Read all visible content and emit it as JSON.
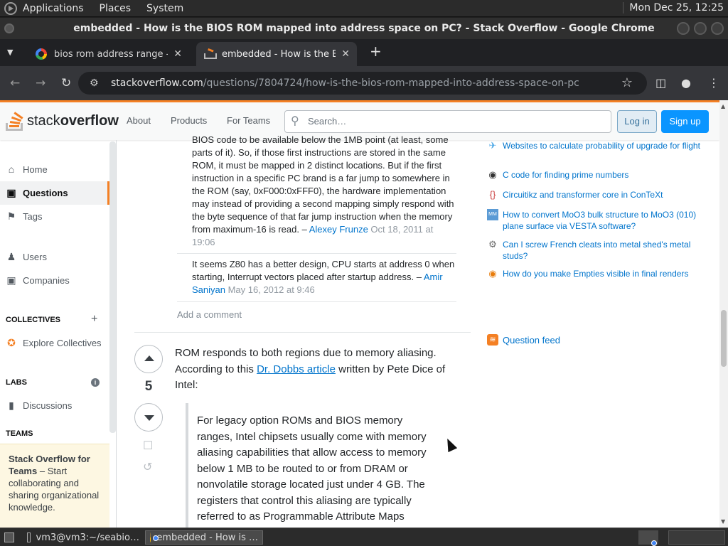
{
  "desktop": {
    "menus": [
      "Applications",
      "Places",
      "System"
    ],
    "clock": "Mon Dec 25, 12:25"
  },
  "window": {
    "title": "embedded - How is the BIOS ROM mapped into address space on PC? - Stack Overflow - Google Chrome"
  },
  "tabs": [
    {
      "title": "bios rom address range - Goo",
      "icon": "google-icon"
    },
    {
      "title": "embedded - How is the BIOS",
      "icon": "stackoverflow-icon"
    }
  ],
  "omnibox": {
    "domain": "stackoverflow.com",
    "path": "/questions/7804724/how-is-the-bios-rom-mapped-into-address-space-on-pc"
  },
  "so_header": {
    "logo_plain": "stack",
    "logo_bold": "overflow",
    "nav": [
      "About",
      "Products",
      "For Teams"
    ],
    "search_placeholder": "Search…",
    "login": "Log in",
    "signup": "Sign up"
  },
  "leftnav": {
    "home": "Home",
    "questions": "Questions",
    "tags": "Tags",
    "users": "Users",
    "companies": "Companies",
    "collectives_head": "COLLECTIVES",
    "explore_collectives": "Explore Collectives",
    "labs_head": "LABS",
    "discussions": "Discussions",
    "teams_head": "TEAMS",
    "teams_title": "Stack Overflow for Teams",
    "teams_desc": " – Start collaborating and sharing organizational knowledge."
  },
  "comments": [
    {
      "text": "BIOS code to be available below the 1MB point (at least, some parts of it). So, if those first instructions are stored in the same ROM, it must be mapped in 2 distinct locations. But if the first instruction in a specific PC brand is a far jump to somewhere in the ROM (say, 0xF000:0xFFF0), the hardware implementation may instead of providing a second mapping simply respond with the byte sequence of that far jump instruction when the memory from maximum-16 is read. – ",
      "user": "Alexey Frunze",
      "time": " Oct 18, 2011 at 19:06"
    },
    {
      "text": "It seems Z80 has a better design, CPU starts at address 0 when starting, Interrupt vectors placed after startup address. – ",
      "user": "Amir Saniyan",
      "time": " May 16, 2012 at 9:46"
    }
  ],
  "add_comment": "Add a comment",
  "answer": {
    "votes": "5",
    "text_before": "ROM responds to both regions due to memory aliasing. According to this ",
    "link": "Dr. Dobbs article",
    "text_after": " written by Pete Dice of Intel:",
    "quote": "For legacy option ROMs and BIOS memory ranges, Intel chipsets usually come with memory aliasing capabilities that allow access to memory below 1 MB to be routed to or from DRAM or nonvolatile storage located just under 4 GB. The registers that control this aliasing are typically referred to as Programmable Attribute Maps"
  },
  "hot_questions": [
    {
      "title": "Websites to calculate probability of upgrade for flight",
      "icon": "travel-icon"
    },
    {
      "title": "C code for finding prime numbers",
      "icon": "codereview-icon"
    },
    {
      "title": "Circuitikz and transformer core in ConTeXt",
      "icon": "tex-icon"
    },
    {
      "title": "How to convert MoO3 bulk structure to MoO3 (010) plane surface via VESTA software?",
      "icon": "matter-modeling-icon"
    },
    {
      "title": "Can I screw French cleats into metal shed's metal studs?",
      "icon": "diy-icon"
    },
    {
      "title": "How do you make Empties visible in final renders",
      "icon": "blender-icon"
    }
  ],
  "question_feed": "Question feed",
  "taskbar": {
    "terminal": "vm3@vm3:~/seabio…",
    "chrome": "embedded - How is …"
  }
}
